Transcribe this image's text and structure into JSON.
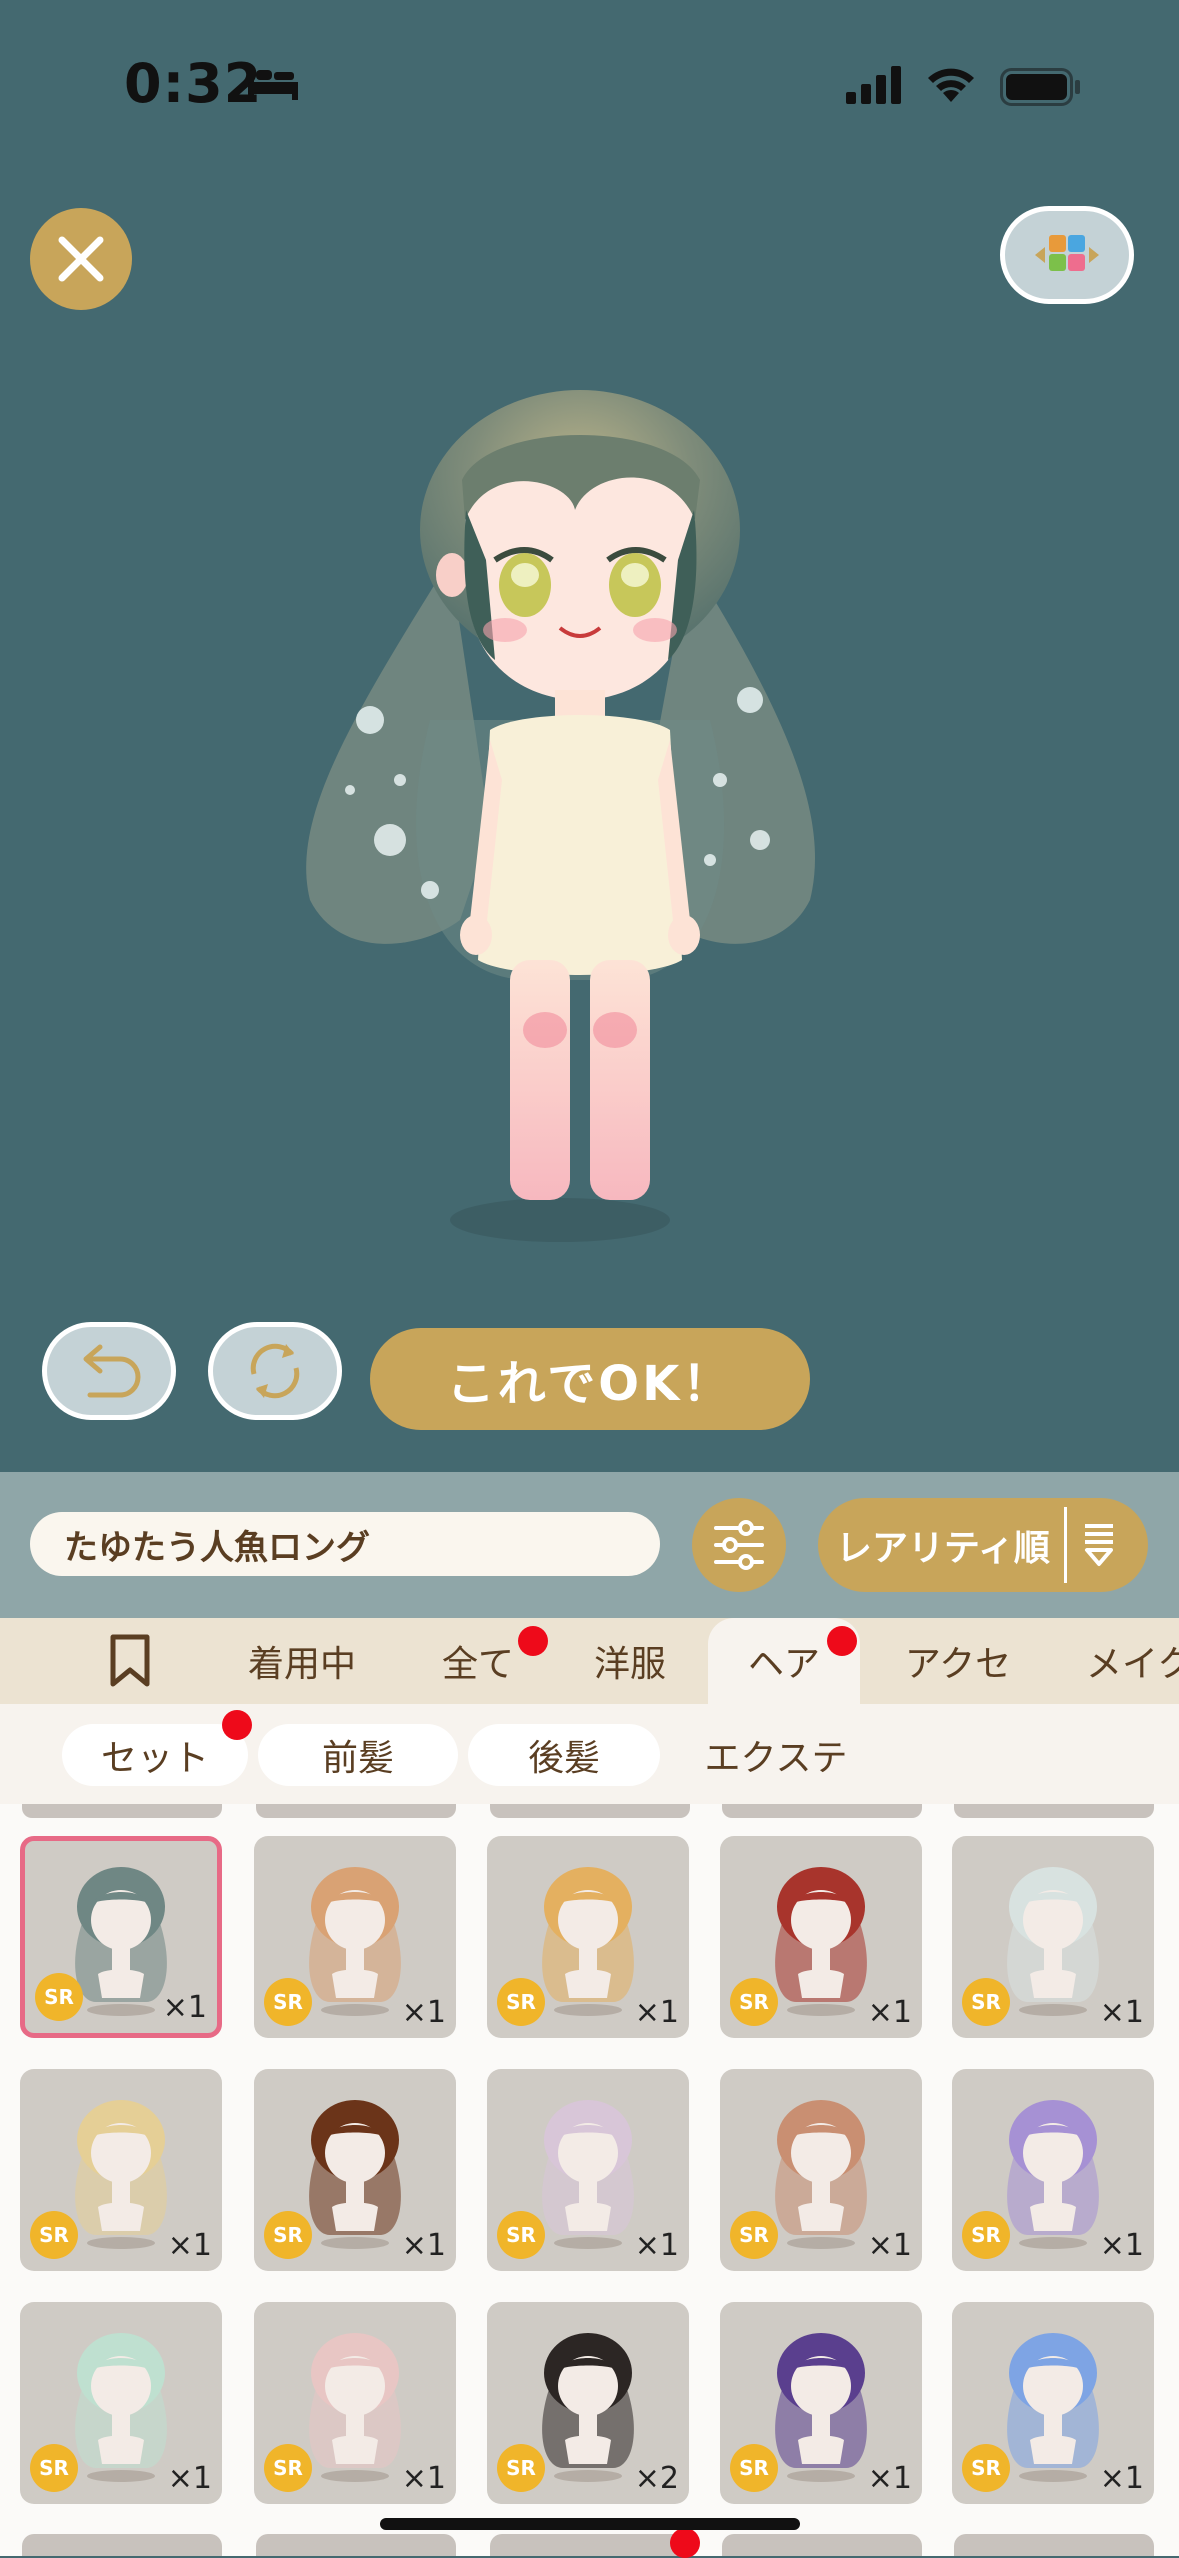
{
  "status_bar": {
    "time": "0:32"
  },
  "actions": {
    "ok_label": "これでOK！"
  },
  "search": {
    "value": "たゆたう人魚ロング"
  },
  "sort": {
    "label": "レアリティ順"
  },
  "tabs": [
    {
      "label": "",
      "icon": "bookmark-icon"
    },
    {
      "label": "着用中"
    },
    {
      "label": "全て",
      "badge": true
    },
    {
      "label": "洋服"
    },
    {
      "label": "ヘア",
      "badge": true,
      "active": true
    },
    {
      "label": "アクセ"
    },
    {
      "label": "メイク"
    }
  ],
  "subtabs": [
    {
      "label": "セット",
      "badge": true
    },
    {
      "label": "前髪"
    },
    {
      "label": "後髪"
    },
    {
      "label": "エクステ"
    }
  ],
  "items": [
    {
      "rarity": "SR",
      "count": "×1",
      "hair": "#6f8784",
      "selected": true
    },
    {
      "rarity": "SR",
      "count": "×1",
      "hair": "#d9a274"
    },
    {
      "rarity": "SR",
      "count": "×1",
      "hair": "#e4b060"
    },
    {
      "rarity": "SR",
      "count": "×1",
      "hair": "#a8342c"
    },
    {
      "rarity": "SR",
      "count": "×1",
      "hair": "#d8e2e0"
    },
    {
      "rarity": "SR",
      "count": "×1",
      "hair": "#e5cf96"
    },
    {
      "rarity": "SR",
      "count": "×1",
      "hair": "#6b3419"
    },
    {
      "rarity": "SR",
      "count": "×1",
      "hair": "#d8c6d8"
    },
    {
      "rarity": "SR",
      "count": "×1",
      "hair": "#c98f72"
    },
    {
      "rarity": "SR",
      "count": "×1",
      "hair": "#a691d4"
    },
    {
      "rarity": "SR",
      "count": "×1",
      "hair": "#bfe0d0"
    },
    {
      "rarity": "SR",
      "count": "×1",
      "hair": "#e8c6c4"
    },
    {
      "rarity": "SR",
      "count": "×2",
      "hair": "#2c2624"
    },
    {
      "rarity": "SR",
      "count": "×1",
      "hair": "#5a3f8e"
    },
    {
      "rarity": "SR",
      "count": "×1",
      "hair": "#7ea4e4"
    }
  ],
  "colors": {
    "background": "#446970",
    "accent": "#c8a55a",
    "badge": "#ee0a1a",
    "selected_border": "#e76a86"
  }
}
